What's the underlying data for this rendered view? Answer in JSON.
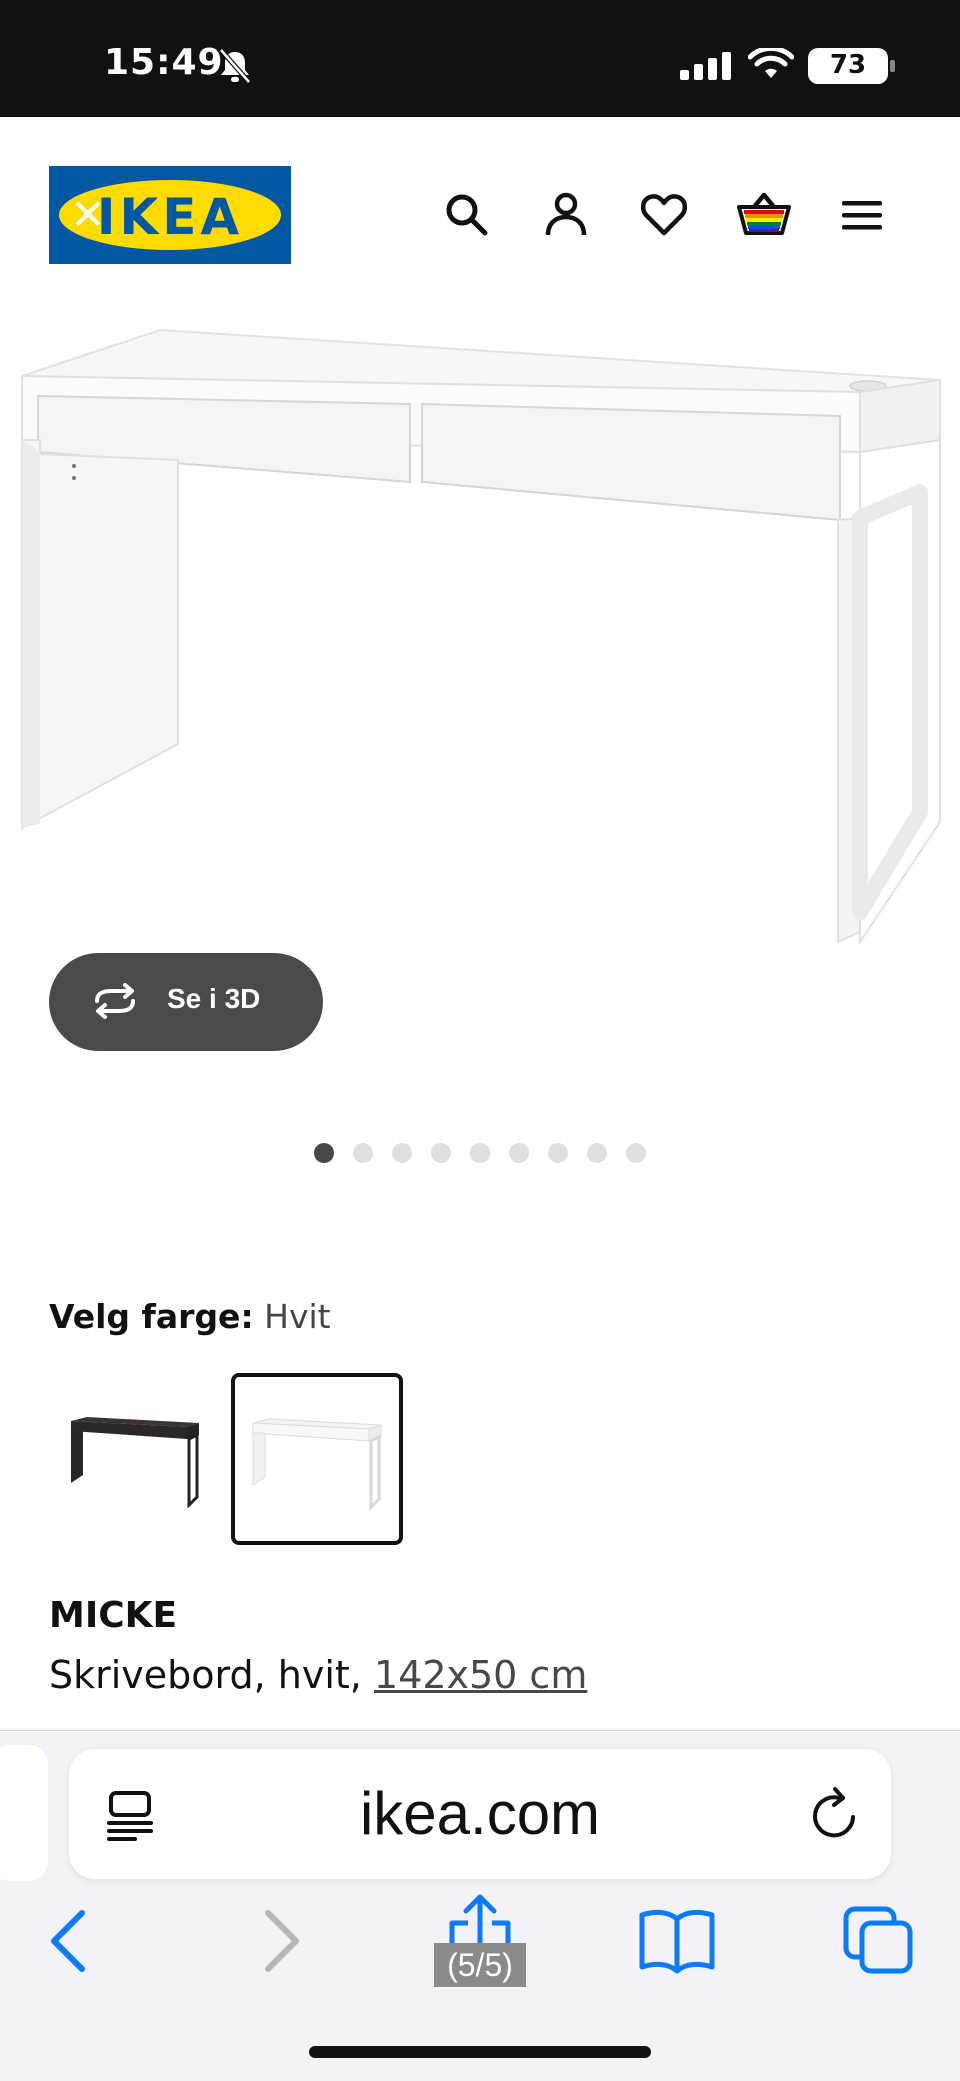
{
  "status_bar": {
    "time": "15:49",
    "battery": "73",
    "icons": [
      "bell-slash-icon",
      "cellular-signal-icon",
      "wifi-icon",
      "battery-icon"
    ]
  },
  "header": {
    "logo_text": "IKEA",
    "icons": [
      "search-icon",
      "account-icon",
      "heart-icon",
      "basket-icon",
      "menu-icon"
    ],
    "colors": {
      "logo_blue": "#0058a3",
      "logo_yellow": "#ffdb00"
    }
  },
  "gallery": {
    "view3d_label": "Se i 3D",
    "dot_count": 9,
    "active_dot": 1
  },
  "color_selector": {
    "title": "Velg farge:",
    "selected": "Hvit",
    "swatches": [
      "black-brown",
      "white"
    ],
    "selected_index": 1
  },
  "product": {
    "name": "MICKE",
    "description": "Skrivebord, hvit,",
    "size": "142x50 cm"
  },
  "browser": {
    "url": "ikea.com",
    "page_counter": "(5/5)",
    "accent": "#0a7aff"
  }
}
